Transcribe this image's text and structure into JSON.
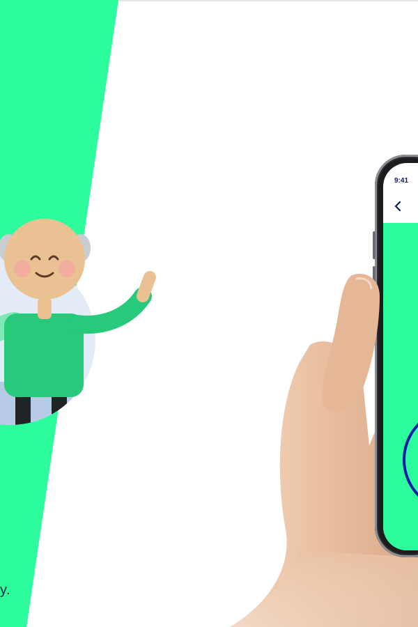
{
  "colors": {
    "brand_green": "#2cfc9c",
    "figure_green": "#27c97b",
    "navy": "#0f1a5c",
    "ring_blue": "#0b1aa8",
    "skin": "#e9c193",
    "halo": "#e3ebf6"
  },
  "caption": {
    "fragment": "y."
  },
  "phone": {
    "status_time": "9:41",
    "back_icon": "chevron-left-icon"
  }
}
